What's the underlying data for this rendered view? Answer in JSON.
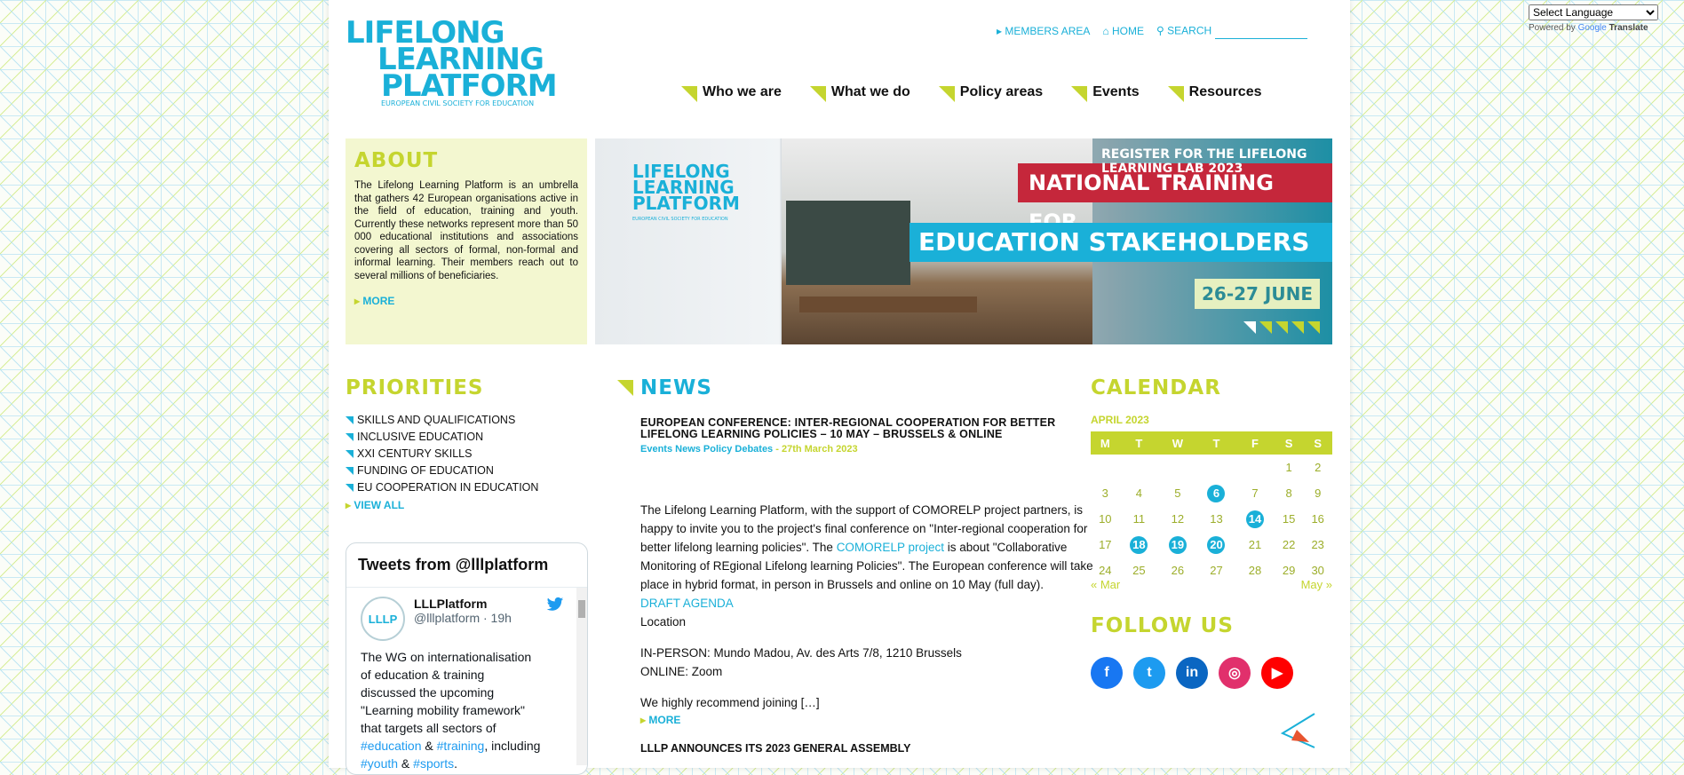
{
  "translate": {
    "select_label": "Select Language",
    "powered_by": "Powered by",
    "google": "Google",
    "translate": "Translate"
  },
  "logo": {
    "line1": "LIFELONG",
    "line2": "LEARNING",
    "line3": "PLATFORM",
    "tagline": "EUROPEAN CIVIL SOCIETY FOR EDUCATION"
  },
  "toplinks": {
    "members": "MEMBERS AREA",
    "home": "HOME",
    "search": "SEARCH"
  },
  "nav": [
    "Who we are",
    "What we do",
    "Policy areas",
    "Events",
    "Resources"
  ],
  "about": {
    "title": "ABOUT",
    "text": "The Lifelong Learning Platform is an umbrella that gathers 42 European organisations active in the field of education, training and youth. Currently these networks represent more than 50 000 educational institutions and associations covering all sectors of formal, non-formal and informal learning. Their members reach out to several millions of beneficiaries.",
    "more": "MORE"
  },
  "banner": {
    "logo_line1": "LIFELONG",
    "logo_line2": "LEARNING",
    "logo_line3": "PLATFORM",
    "logo_tag": "EUROPEAN CIVIL SOCIETY FOR EDUCATION",
    "register": "REGISTER FOR THE LIFELONG LEARNING LAB 2023",
    "national": "NATIONAL TRAINING FOR",
    "education": "EDUCATION STAKEHOLDERS",
    "dates": "26-27 JUNE"
  },
  "priorities": {
    "title": "PRIORITIES",
    "items": [
      "SKILLS AND QUALIFICATIONS",
      "INCLUSIVE EDUCATION",
      "XXI CENTURY SKILLS",
      "FUNDING OF EDUCATION",
      "EU COOPERATION IN EDUCATION"
    ],
    "view_all": "VIEW ALL"
  },
  "tweets": {
    "title": "Tweets from @lllplatform",
    "avatar_text": "LLLP",
    "name": "LLLPlatform",
    "handle": "@lllplatform · 19h",
    "text_before": "The WG on internationalisation of education & training discussed the upcoming \"Learning mobility framework\" that targets all sectors of",
    "tag1": "#education",
    "amp": " & ",
    "tag2": "#training",
    "after": ", including ",
    "tag3": "#youth",
    "tag4": "#sports",
    "tail": "."
  },
  "news": {
    "title": "NEWS",
    "item_title": "EUROPEAN CONFERENCE: INTER-REGIONAL COOPERATION FOR BETTER LIFELONG LEARNING POLICIES – 10 MAY – BRUSSELS & ONLINE",
    "categories": "Events News Policy Debates",
    "date": " - 27th March 2023",
    "p1_a": "The Lifelong Learning Platform, with the support of COMORELP project partners, is happy to invite you to the project's final conference on \"Inter-regional cooperation for better lifelong learning policies\". The ",
    "p1_link": "COMORELP project",
    "p1_b": " is about \"Collaborative Monitoring of REgional Lifelong learning Policies\". The European conference will take place in hybrid format, in person in Brussels and online on 10 May (full day).",
    "agenda": "DRAFT AGENDA",
    "location": "Location",
    "in_person": "IN-PERSON: Mundo Madou, Av. des Arts 7/8, 1210 Brussels",
    "online": "ONLINE: Zoom",
    "recommend": "We highly recommend joining […]",
    "more": "MORE",
    "next_title": "LLLP ANNOUNCES ITS 2023 GENERAL ASSEMBLY"
  },
  "calendar": {
    "title": "CALENDAR",
    "month": "APRIL 2023",
    "days": [
      "M",
      "T",
      "W",
      "T",
      "F",
      "S",
      "S"
    ],
    "weeks": [
      [
        "",
        "",
        "",
        "",
        "",
        "1",
        "2"
      ],
      [
        "3",
        "4",
        "5",
        "6",
        "7",
        "8",
        "9"
      ],
      [
        "10",
        "11",
        "12",
        "13",
        "14",
        "15",
        "16"
      ],
      [
        "17",
        "18",
        "19",
        "20",
        "21",
        "22",
        "23"
      ],
      [
        "24",
        "25",
        "26",
        "27",
        "28",
        "29",
        "30"
      ]
    ],
    "event_days": [
      "6",
      "14",
      "18",
      "19",
      "20"
    ],
    "prev": "« Mar",
    "next": "May »"
  },
  "follow": {
    "title": "FOLLOW US",
    "networks": [
      "facebook",
      "twitter",
      "linkedin",
      "instagram",
      "youtube"
    ]
  },
  "colors": {
    "lime": "#c5d52f",
    "blue": "#1ab0d8",
    "red": "#c5273b"
  }
}
